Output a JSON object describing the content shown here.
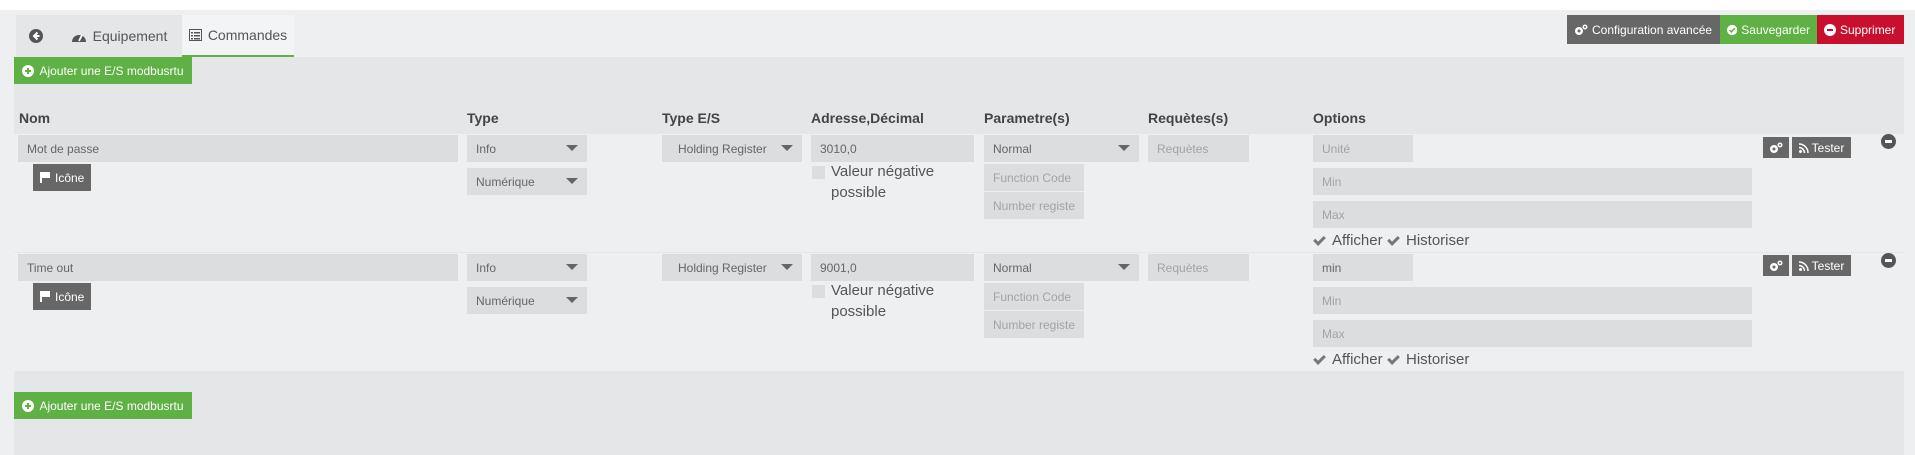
{
  "tabs": {
    "back_label": "",
    "equipement_label": "Equipement",
    "commandes_label": "Commandes"
  },
  "toolbar": {
    "config_label": "Configuration avancée",
    "save_label": "Sauvegarder",
    "delete_label": "Supprimer"
  },
  "add_button_label": "Ajouter une E/S modbusrtu",
  "headers": {
    "nom": "Nom",
    "type": "Type",
    "type_es": "Type E/S",
    "adresse": "Adresse,Décimal",
    "parametres": "Parametre(s)",
    "requetes": "Requètes(s)",
    "options": "Options"
  },
  "commands": [
    {
      "name": "Mot de passe",
      "icon_button": "Icône",
      "type": "Info",
      "subtype": "Numérique",
      "type_es": "Holding Register",
      "address": "3010,0",
      "negative_label_line1": "Valeur négative",
      "negative_label_line2": "possible",
      "param": "Normal",
      "function_code_placeholder": "Function Code",
      "number_registers_placeholder": "Number registe",
      "requetes_placeholder": "Requètes",
      "unite": "",
      "unite_placeholder": "Unité",
      "min_placeholder": "Min",
      "max_placeholder": "Max",
      "afficher": "Afficher",
      "historiser": "Historiser",
      "tester": "Tester"
    },
    {
      "name": "Time out",
      "icon_button": "Icône",
      "type": "Info",
      "subtype": "Numérique",
      "type_es": "Holding Register",
      "address": "9001,0",
      "negative_label_line1": "Valeur négative",
      "negative_label_line2": "possible",
      "param": "Normal",
      "function_code_placeholder": "Function Code",
      "number_registers_placeholder": "Number registe",
      "requetes_placeholder": "Requètes",
      "unite": "min",
      "unite_placeholder": "",
      "min_placeholder": "Min",
      "max_placeholder": "Max",
      "afficher": "Afficher",
      "historiser": "Historiser",
      "tester": "Tester"
    }
  ],
  "colors": {
    "green": "#5fb045",
    "red": "#c8102e",
    "gray": "#676767"
  }
}
